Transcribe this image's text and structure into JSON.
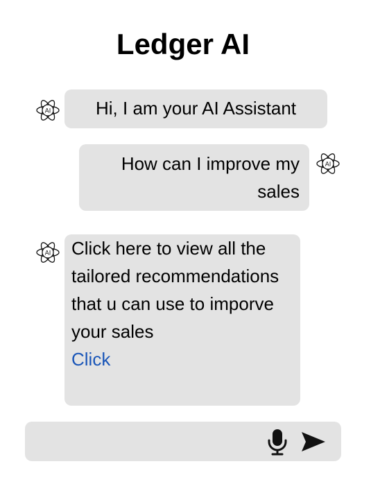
{
  "header": {
    "title": "Ledger AI"
  },
  "messages": [
    {
      "sender": "assistant",
      "text": "Hi, I am your AI Assistant"
    },
    {
      "sender": "user",
      "text": "How can I improve my sales"
    },
    {
      "sender": "assistant",
      "text": "Click here to view all the tailored recommendations that u can use to imporve your sales",
      "link_label": "Click"
    }
  ],
  "avatar": {
    "label": "AI",
    "icon": "ai-atom-icon"
  },
  "composer": {
    "value": "",
    "placeholder": "",
    "mic_icon": "microphone-icon",
    "send_icon": "send-icon"
  },
  "colors": {
    "bubble": "#e3e3e3",
    "link": "#1a56b8",
    "text": "#000000"
  }
}
